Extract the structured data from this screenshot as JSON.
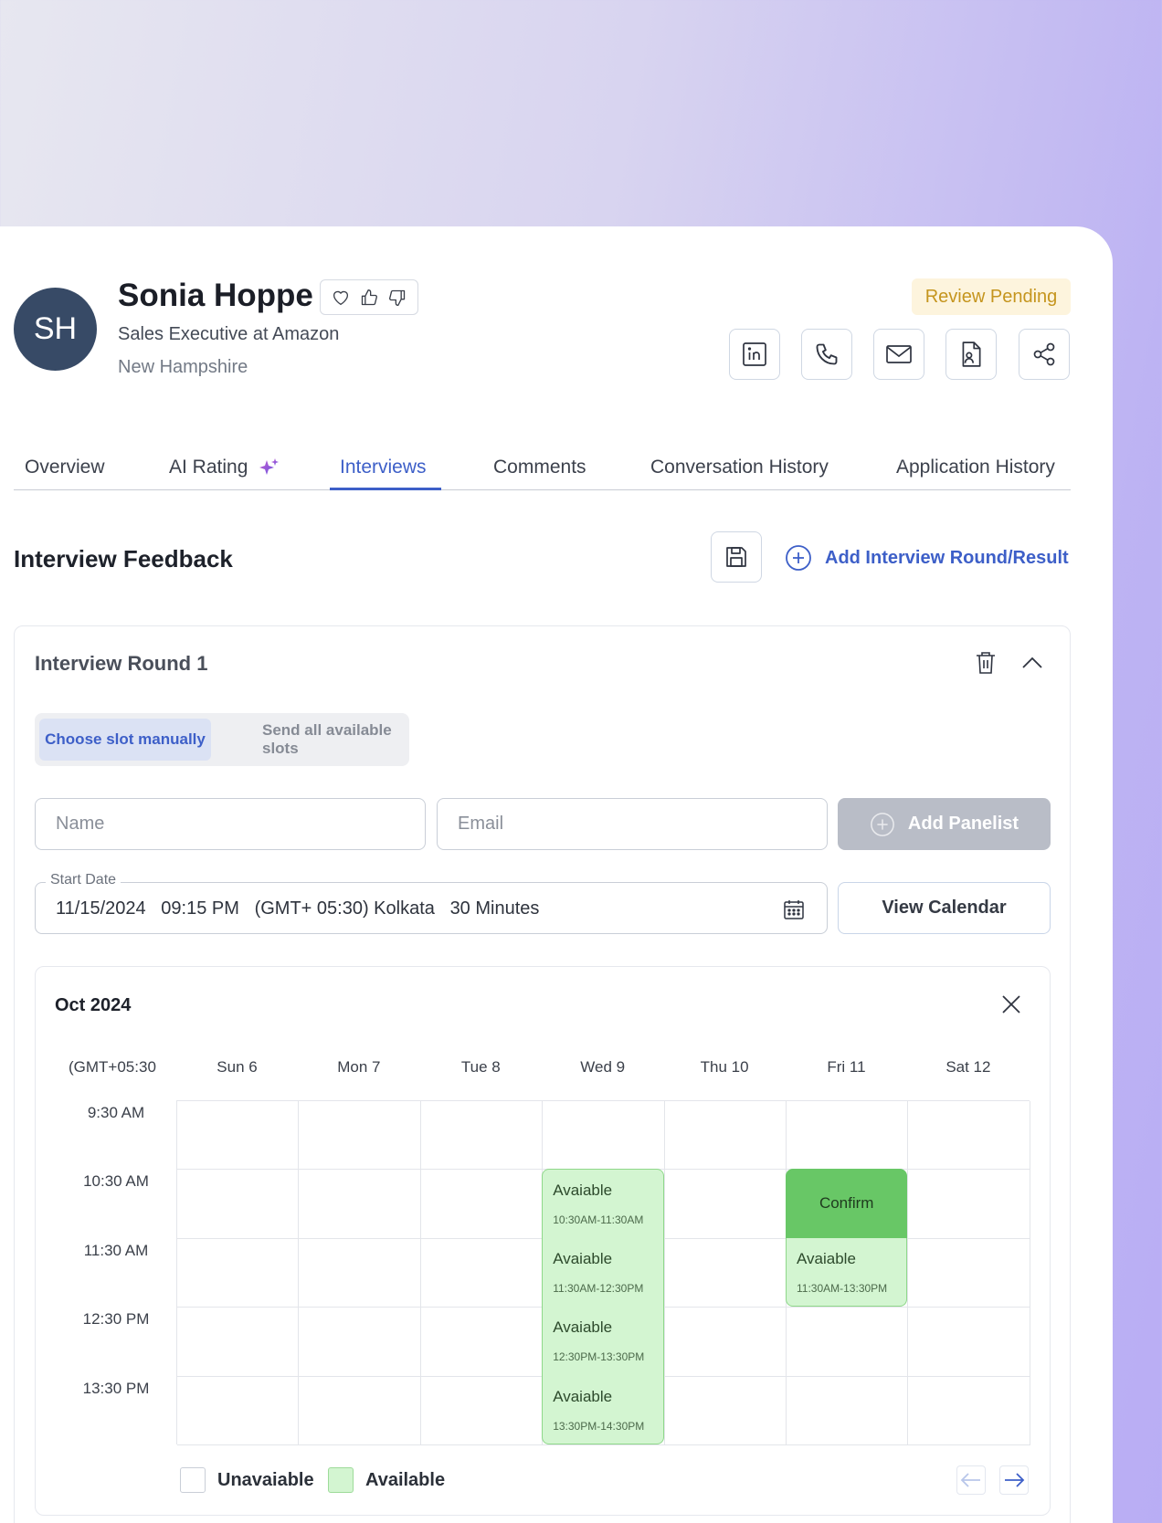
{
  "candidate": {
    "initials": "SH",
    "name": "Sonia Hoppe",
    "title": "Sales Executive at Amazon",
    "location": "New Hampshire",
    "status": "Review Pending"
  },
  "reactions": [
    "heart-icon",
    "thumbs-up-icon",
    "thumbs-down-icon"
  ],
  "actions": [
    "linkedin-icon",
    "phone-icon",
    "mail-icon",
    "resume-icon",
    "share-icon"
  ],
  "tabs": [
    {
      "label": "Overview"
    },
    {
      "label": "AI Rating"
    },
    {
      "label": "Interviews",
      "active": true
    },
    {
      "label": "Comments"
    },
    {
      "label": "Conversation History"
    },
    {
      "label": "Application History"
    }
  ],
  "feedback": {
    "title": "Interview Feedback",
    "add_round_label": "Add Interview Round/Result"
  },
  "round": {
    "title": "Interview Round 1",
    "mode_options": [
      "Choose slot manually",
      "Send all available slots"
    ],
    "name_placeholder": "Name",
    "email_placeholder": "Email",
    "add_panelist_label": "Add Panelist",
    "start_date_label": "Start Date",
    "start_date": "11/15/2024",
    "start_time": "09:15 PM",
    "timezone": "(GMT+ 05:30) Kolkata",
    "duration": "30 Minutes",
    "view_calendar_label": "View Calendar"
  },
  "calendar": {
    "month": "Oct 2024",
    "timezone_label": "(GMT+05:30",
    "days": [
      "Sun 6",
      "Mon 7",
      "Tue 8",
      "Wed 9",
      "Thu 10",
      "Fri 11",
      "Sat 12"
    ],
    "times": [
      "9:30 AM",
      "10:30 AM",
      "11:30 AM",
      "12:30 PM",
      "13:30 PM"
    ],
    "slots": [
      {
        "day": 3,
        "row": 1,
        "label": "Avaiable",
        "range": "10:30AM-11:30AM"
      },
      {
        "day": 3,
        "row": 2,
        "label": "Avaiable",
        "range": "11:30AM-12:30PM"
      },
      {
        "day": 3,
        "row": 3,
        "label": "Avaiable",
        "range": "12:30PM-13:30PM"
      },
      {
        "day": 3,
        "row": 4,
        "label": "Avaiable",
        "range": "13:30PM-14:30PM"
      },
      {
        "day": 5,
        "row": 2,
        "label": "Avaiable",
        "range": "11:30AM-13:30PM"
      }
    ],
    "confirm": {
      "day": 5,
      "row": 1,
      "label": "Confirm"
    },
    "legend": {
      "unavailable": "Unavaiable",
      "available": "Available"
    }
  },
  "colors": {
    "accent": "#3d5fc8",
    "available": "#d3f5d1",
    "confirm": "#68c766",
    "badge_bg": "#fdf4dd",
    "badge_text": "#c5951e"
  }
}
